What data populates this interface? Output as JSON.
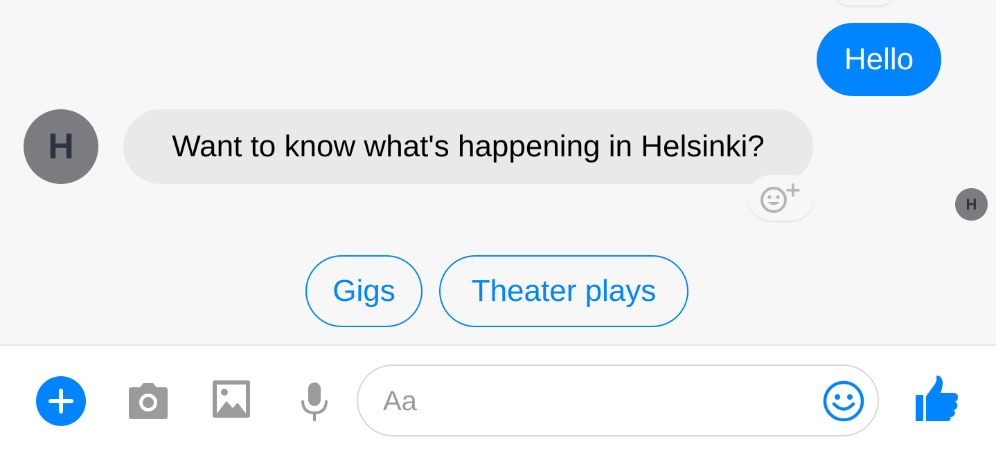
{
  "conversation": {
    "outgoing_message": "Hello",
    "incoming_message": "Want to know what's happening in Helsinki?",
    "sender_avatar_initial": "H",
    "seen_avatar_initial": "H"
  },
  "quick_replies": [
    {
      "label": "Gigs"
    },
    {
      "label": "Theater plays"
    }
  ],
  "composer": {
    "placeholder": "Aa",
    "value": ""
  },
  "icons": {
    "add": "plus-icon",
    "camera": "camera-icon",
    "gallery": "image-icon",
    "voice": "microphone-icon",
    "emoji": "smiley-icon",
    "like": "thumbs-up-icon",
    "reaction": "add-reaction-icon"
  },
  "colors": {
    "accent": "#0084ff",
    "incoming_bubble": "#e9e9e9",
    "avatar": "#7b7c80",
    "icon_gray": "#9b9b9b"
  }
}
